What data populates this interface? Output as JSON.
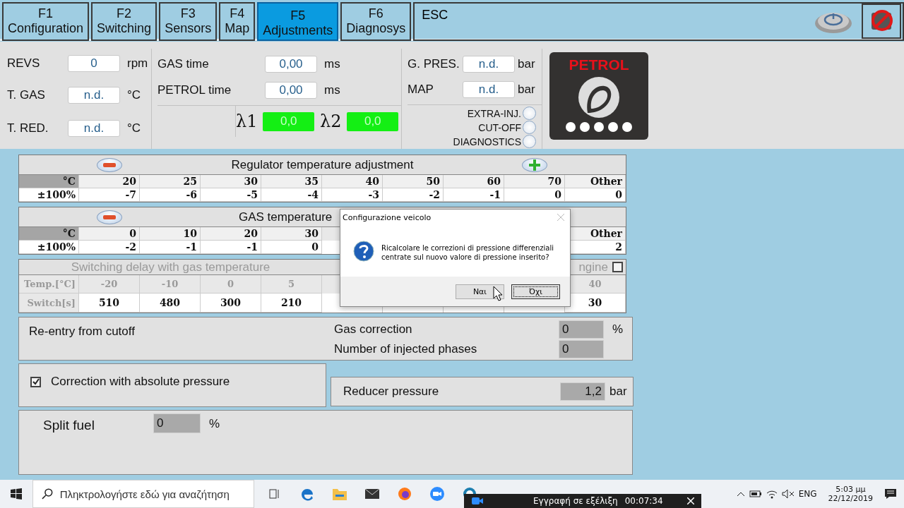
{
  "tabs": [
    {
      "key": "F1",
      "label": "Configuration",
      "selected": false
    },
    {
      "key": "F2",
      "label": "Switching",
      "selected": false
    },
    {
      "key": "F3",
      "label": "Sensors",
      "selected": false
    },
    {
      "key": "F4",
      "label": "Map",
      "selected": false
    },
    {
      "key": "F5",
      "label": "Adjustments",
      "selected": true
    },
    {
      "key": "F6",
      "label": "Diagnosys",
      "selected": false
    }
  ],
  "esc_tab": {
    "label": "ESC"
  },
  "readings": [
    {
      "label": "REVS",
      "value": "0",
      "unit": "rpm"
    },
    {
      "label": "T. GAS",
      "value": "n.d.",
      "unit": "°C"
    },
    {
      "label": "T. RED.",
      "value": "n.d.",
      "unit": "°C"
    }
  ],
  "times": [
    {
      "label": "GAS time",
      "value": "0,00",
      "unit": "ms"
    },
    {
      "label": "PETROL time",
      "value": "0,00",
      "unit": "ms"
    }
  ],
  "lambdas": [
    {
      "symbol": "λ1",
      "value": "0,0"
    },
    {
      "symbol": "λ2",
      "value": "0,0"
    }
  ],
  "pressures": [
    {
      "label": "G. PRES.",
      "value": "n.d.",
      "unit": "bar"
    },
    {
      "label": "MAP",
      "value": "n.d.",
      "unit": "bar"
    }
  ],
  "indicators": [
    {
      "label": "EXTRA-INJ.",
      "on": false
    },
    {
      "label": "CUT-OFF",
      "on": false
    },
    {
      "label": "DIAGNOSTICS",
      "on": false
    }
  ],
  "logo": {
    "text": "PETROL"
  },
  "regulator_table": {
    "title": "Regulator temperature adjustment",
    "buttons": [
      {
        "kind": "minus"
      },
      {
        "kind": "plus"
      }
    ],
    "row_headers": [
      "°C",
      "±100%"
    ],
    "columns": [
      {
        "header": "20",
        "value": "-7"
      },
      {
        "header": "25",
        "value": "-6"
      },
      {
        "header": "30",
        "value": "-5"
      },
      {
        "header": "35",
        "value": "-4"
      },
      {
        "header": "40",
        "value": "-3"
      },
      {
        "header": "50",
        "value": "-2"
      },
      {
        "header": "60",
        "value": "-1"
      },
      {
        "header": "70",
        "value": "0"
      }
    ],
    "last": {
      "header": "Other",
      "value": "0"
    }
  },
  "gas_table": {
    "title": "GAS temperature",
    "buttons": [
      {
        "kind": "minus"
      }
    ],
    "row_headers": [
      "°C",
      "±100%"
    ],
    "columns": [
      {
        "header": "0",
        "value": "-2"
      },
      {
        "header": "10",
        "value": "-1"
      },
      {
        "header": "20",
        "value": "-1"
      },
      {
        "header": "30",
        "value": "0"
      }
    ],
    "last": {
      "header": "Other",
      "value": "2"
    }
  },
  "switching_table": {
    "title": "Switching delay with gas temperature",
    "engine_label": "ngine",
    "engine_checked": false,
    "row_headers": [
      "Temp.[°C]",
      "Switch[s]"
    ],
    "columns": [
      {
        "header": "-20",
        "value": "510"
      },
      {
        "header": "-10",
        "value": "480"
      },
      {
        "header": "0",
        "value": "300"
      },
      {
        "header": "5",
        "value": "210"
      }
    ],
    "last": {
      "header": "40",
      "value": "30"
    }
  },
  "cutoff": {
    "title": "Re-entry from cutoff",
    "fields": [
      {
        "label": "Gas correction",
        "value": "0",
        "unit": "%"
      },
      {
        "label": "Number of injected phases",
        "value": "0"
      }
    ]
  },
  "absolute_pressure": {
    "label": "Correction with absolute pressure",
    "checked": true
  },
  "reducer": {
    "label": "Reducer pressure",
    "value": "1,2",
    "unit": "bar"
  },
  "split_fuel": {
    "label": "Split fuel",
    "value": "0",
    "unit": "%"
  },
  "dialog": {
    "title": "Configurazione veicolo",
    "message": "Ricalcolare le correzioni di pressione differenziali\ncentrate sul nuovo valore di pressione inserito?",
    "buttons": [
      {
        "label": "Ναι",
        "selected": false
      },
      {
        "label": "Όχι",
        "selected": true
      }
    ]
  },
  "taskbar": {
    "search_placeholder": "Πληκτρολογήστε εδώ για αναζήτηση",
    "recording": {
      "label": "Εγγραφή σε εξέλιξη",
      "time": "00:07:34"
    },
    "language": "ENG",
    "time": "5:03 μμ",
    "date": "22/12/2019"
  }
}
